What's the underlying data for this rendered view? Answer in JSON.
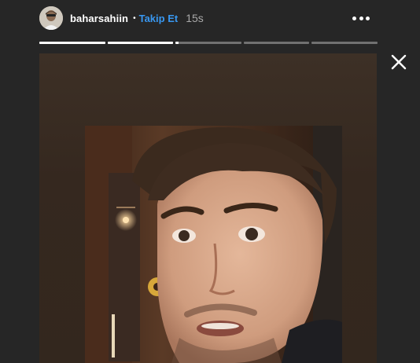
{
  "header": {
    "username": "baharsahiin",
    "separator": "•",
    "follow_label": "Takip Et",
    "time": "15s"
  },
  "progress": {
    "segments": [
      1,
      1,
      0.05,
      0,
      0
    ]
  },
  "icons": {
    "more": "more-horizontal-icon",
    "close": "close-icon",
    "avatar": "profile-avatar"
  },
  "colors": {
    "background": "#262626",
    "follow": "#3897f0",
    "text": "#ffffff",
    "time": "#a8a8a8"
  }
}
